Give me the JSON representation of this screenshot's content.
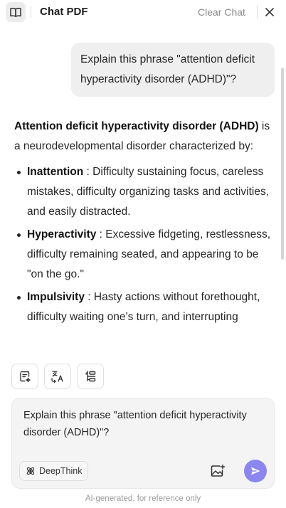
{
  "header": {
    "title": "Chat PDF",
    "clear_label": "Clear Chat",
    "icons": {
      "book": "book-open-icon",
      "close": "close-icon"
    }
  },
  "chat": {
    "user_message": "Explain this phrase \"attention deficit hyperactivity disorder (ADHD)\"?",
    "answer": {
      "intro_bold": "Attention deficit hyperactivity disorder (ADHD)",
      "intro_rest": " is a neurodevelopmental disorder characterized by:",
      "items": [
        {
          "term": "Inattention",
          "text": " : Difficulty sustaining focus, careless mistakes, difficulty organizing tasks and activities, and easily distracted."
        },
        {
          "term": "Hyperactivity",
          "text": " : Excessive fidgeting, restlessness, difficulty remaining seated, and appearing to be \"on the go.\""
        },
        {
          "term": "Impulsivity",
          "text": " : Hasty actions without forethought, difficulty waiting one’s turn, and interrupting"
        }
      ]
    }
  },
  "toolbar": {
    "icons": [
      "summarize-icon",
      "translate-icon",
      "outline-icon"
    ]
  },
  "composer": {
    "value": "Explain this phrase \"attention deficit hyperactivity disorder (ADHD)\"?",
    "deepthink_label": "DeepThink",
    "icons": {
      "deepthink": "atom-icon",
      "image": "image-upload-icon",
      "send": "send-icon"
    }
  },
  "footer": {
    "disclaimer": "AI-generated, for reference only"
  },
  "colors": {
    "accent": "#8b86f0",
    "bubble": "#efefef",
    "muted_text": "#8a8a8a"
  }
}
